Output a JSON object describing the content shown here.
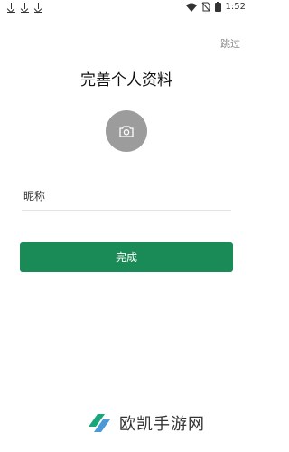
{
  "status_bar": {
    "time": "1:52",
    "icons": [
      "download-icon",
      "download-icon",
      "download-icon",
      "wifi-icon",
      "no-sim-icon",
      "battery-icon"
    ]
  },
  "header": {
    "skip_label": "跳过"
  },
  "main": {
    "title": "完善个人资料",
    "avatar_icon": "camera-icon",
    "nickname_label": "昵称",
    "nickname_value": "",
    "submit_label": "完成"
  },
  "watermark": {
    "text": "欧凯手游网"
  },
  "colors": {
    "accent": "#1a8a57",
    "avatar_bg": "#9c9c9c"
  }
}
